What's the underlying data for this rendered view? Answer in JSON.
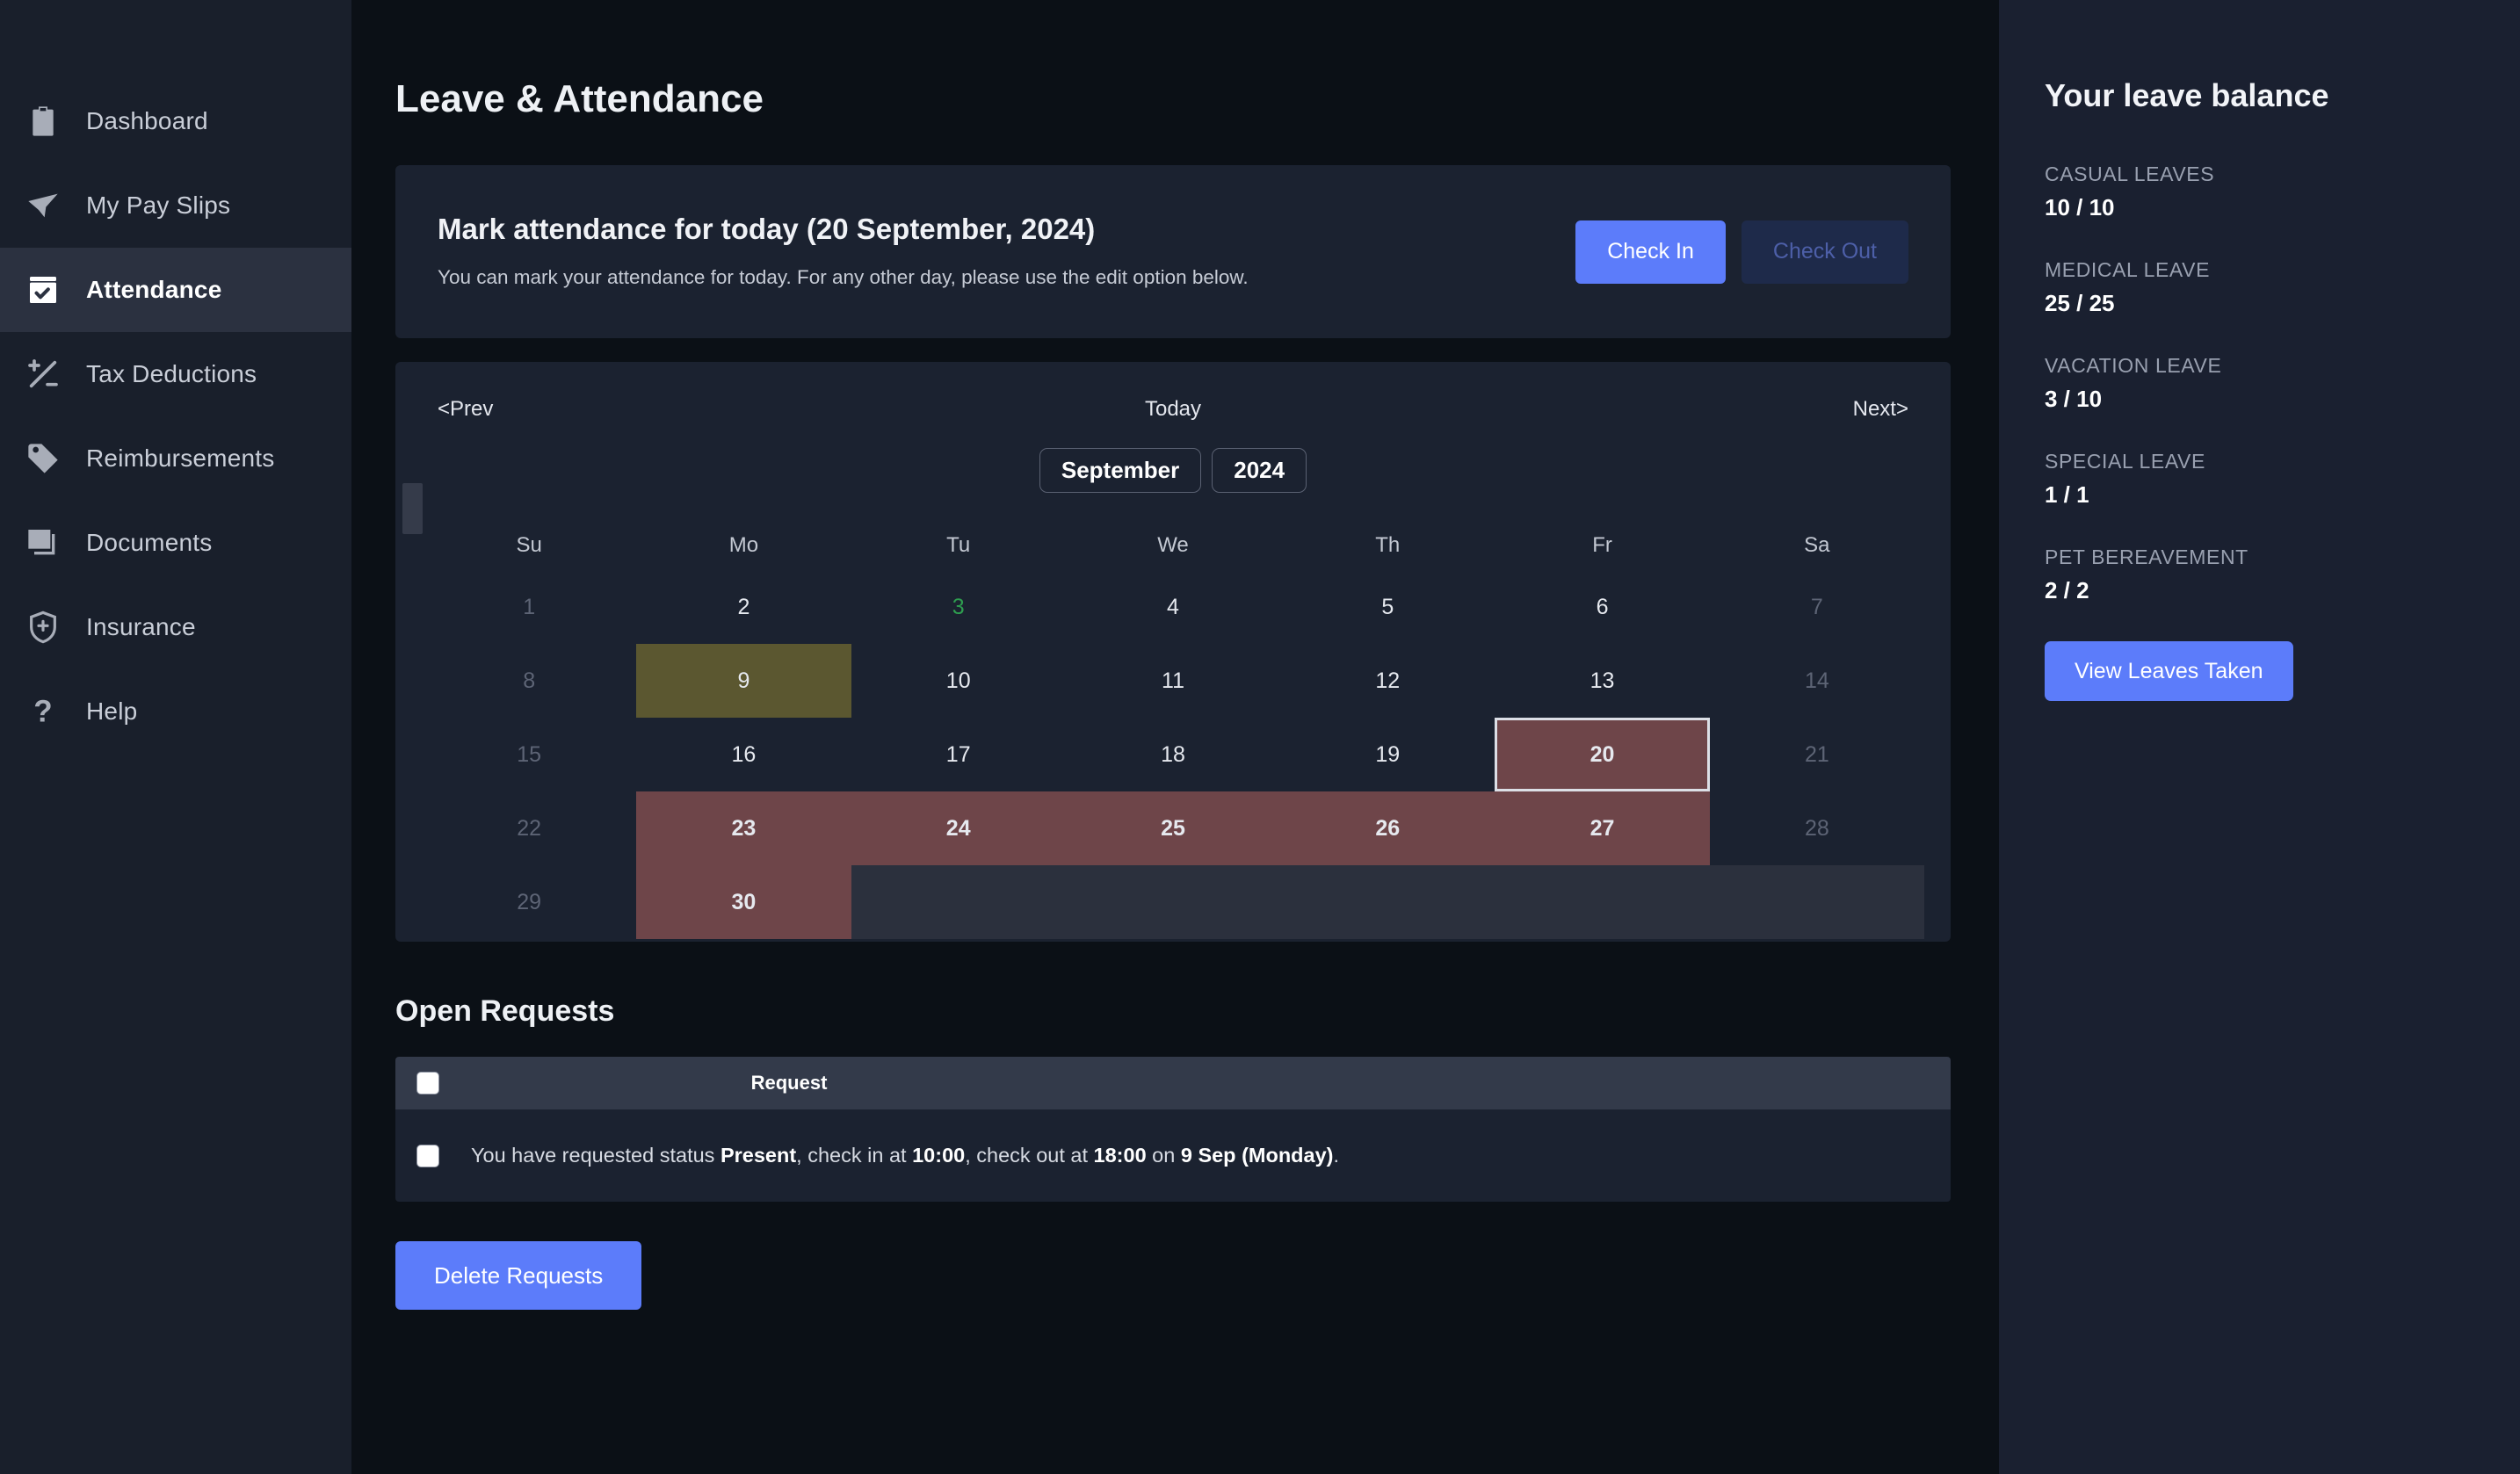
{
  "sidebar": {
    "items": [
      {
        "label": "Dashboard",
        "icon": "clipboard-icon",
        "active": false
      },
      {
        "label": "My Pay Slips",
        "icon": "paper-plane-icon",
        "active": false
      },
      {
        "label": "Attendance",
        "icon": "calendar-check-icon",
        "active": true
      },
      {
        "label": "Tax Deductions",
        "icon": "plus-minus-icon",
        "active": false
      },
      {
        "label": "Reimbursements",
        "icon": "tag-icon",
        "active": false
      },
      {
        "label": "Documents",
        "icon": "documents-icon",
        "active": false
      },
      {
        "label": "Insurance",
        "icon": "shield-plus-icon",
        "active": false
      },
      {
        "label": "Help",
        "icon": "question-mark-icon",
        "active": false
      }
    ]
  },
  "main": {
    "page_title": "Leave & Attendance",
    "attendance": {
      "title": "Mark attendance for today (20 September, 2024)",
      "subtitle": "You can mark your attendance for today. For any other day, please use the edit option below.",
      "check_in_label": "Check In",
      "check_out_label": "Check Out"
    },
    "calendar": {
      "prev_label": "<Prev",
      "today_label": "Today",
      "next_label": "Next>",
      "month": "September",
      "year": "2024",
      "dow": [
        "Su",
        "Mo",
        "Tu",
        "We",
        "Th",
        "Fr",
        "Sa"
      ],
      "weeks": [
        [
          {
            "d": "1",
            "style": "weekend"
          },
          {
            "d": "2",
            "style": ""
          },
          {
            "d": "3",
            "style": "green"
          },
          {
            "d": "4",
            "style": ""
          },
          {
            "d": "5",
            "style": ""
          },
          {
            "d": "6",
            "style": ""
          },
          {
            "d": "7",
            "style": "weekend"
          }
        ],
        [
          {
            "d": "8",
            "style": "weekend"
          },
          {
            "d": "9",
            "style": "olive"
          },
          {
            "d": "10",
            "style": ""
          },
          {
            "d": "11",
            "style": ""
          },
          {
            "d": "12",
            "style": ""
          },
          {
            "d": "13",
            "style": ""
          },
          {
            "d": "14",
            "style": "weekend"
          }
        ],
        [
          {
            "d": "15",
            "style": "weekend"
          },
          {
            "d": "16",
            "style": ""
          },
          {
            "d": "17",
            "style": ""
          },
          {
            "d": "18",
            "style": ""
          },
          {
            "d": "19",
            "style": ""
          },
          {
            "d": "20",
            "style": "today"
          },
          {
            "d": "21",
            "style": "weekend"
          }
        ],
        [
          {
            "d": "22",
            "style": "weekend"
          },
          {
            "d": "23",
            "style": "maroon"
          },
          {
            "d": "24",
            "style": "maroon"
          },
          {
            "d": "25",
            "style": "maroon"
          },
          {
            "d": "26",
            "style": "maroon"
          },
          {
            "d": "27",
            "style": "maroon"
          },
          {
            "d": "28",
            "style": "weekend"
          }
        ],
        [
          {
            "d": "29",
            "style": "weekend"
          },
          {
            "d": "30",
            "style": "maroon"
          },
          {
            "d": "",
            "style": "gray"
          },
          {
            "d": "",
            "style": "gray"
          },
          {
            "d": "",
            "style": "gray"
          },
          {
            "d": "",
            "style": "gray"
          },
          {
            "d": "",
            "style": "gray"
          }
        ]
      ]
    },
    "open_requests": {
      "title": "Open Requests",
      "column_header": "Request",
      "rows": [
        {
          "prefix": "You have requested status ",
          "status": "Present",
          "mid1": ", check in at ",
          "check_in": "10:00",
          "mid2": ", check out at ",
          "check_out": "18:00",
          "mid3": " on ",
          "date": "9 Sep (Monday)",
          "suffix": "."
        }
      ],
      "delete_label": "Delete Requests"
    }
  },
  "right_panel": {
    "title": "Your leave balance",
    "balances": [
      {
        "name": "CASUAL LEAVES",
        "value": "10 / 10"
      },
      {
        "name": "MEDICAL LEAVE",
        "value": "25 / 25"
      },
      {
        "name": "VACATION LEAVE",
        "value": "3 / 10"
      },
      {
        "name": "SPECIAL LEAVE",
        "value": "1 / 1"
      },
      {
        "name": "PET BEREAVEMENT",
        "value": "2 / 2"
      }
    ],
    "view_button_label": "View Leaves Taken"
  },
  "colors": {
    "accent": "#5c7cfa",
    "today_cell": "#6e4549",
    "requested_cell": "#5b5730",
    "panel_bg": "#1b2230",
    "app_bg": "#0b1016"
  }
}
